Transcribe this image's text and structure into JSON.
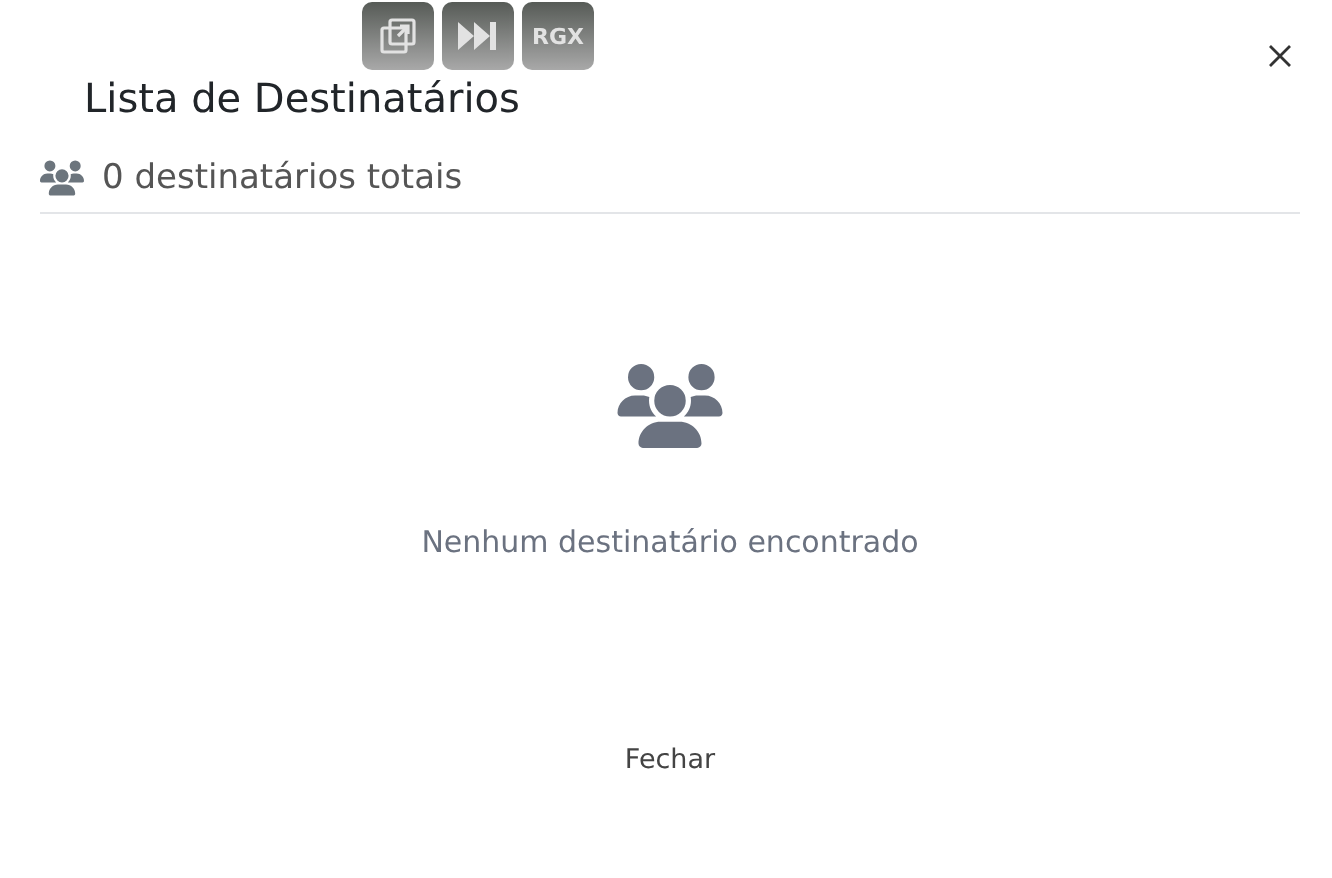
{
  "dialog": {
    "title": "Lista de Destinatários",
    "count_text": "0 destinatários totais",
    "empty_message": "Nenhum destinatário encontrado",
    "buttons": [
      "Fechar"
    ]
  },
  "overlay_toolbar": {
    "buttons": [
      {
        "kind": "popout"
      },
      {
        "kind": "skip"
      },
      {
        "kind": "text",
        "label": "RGX"
      }
    ]
  }
}
